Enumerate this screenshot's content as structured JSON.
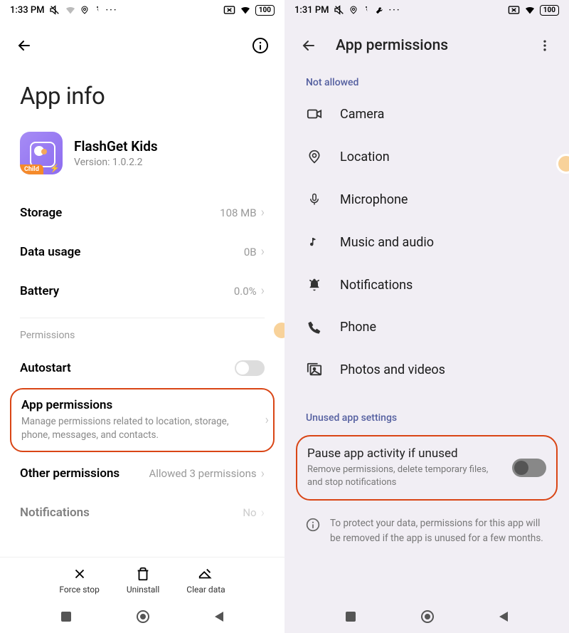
{
  "left": {
    "status": {
      "time": "1:33 PM",
      "battery": "100"
    },
    "page_title": "App info",
    "app": {
      "name": "FlashGet Kids",
      "version": "Version: 1.0.2.2",
      "child_badge": "Child"
    },
    "rows": {
      "storage": {
        "label": "Storage",
        "value": "108 MB"
      },
      "data": {
        "label": "Data usage",
        "value": "0B"
      },
      "battery": {
        "label": "Battery",
        "value": "0.0%"
      }
    },
    "sections": {
      "permissions": "Permissions"
    },
    "autostart": {
      "label": "Autostart"
    },
    "app_perms": {
      "label": "App permissions",
      "sub": "Manage permissions related to location, storage, phone, messages, and contacts."
    },
    "other_perms": {
      "label": "Other permissions",
      "value": "Allowed 3 permissions"
    },
    "notifications": {
      "label": "Notifications",
      "value": "No"
    },
    "actions": {
      "force_stop": "Force stop",
      "uninstall": "Uninstall",
      "clear_data": "Clear data"
    }
  },
  "right": {
    "status": {
      "time": "1:31 PM",
      "battery": "100"
    },
    "header_title": "App permissions",
    "sections": {
      "not_allowed": "Not allowed",
      "unused": "Unused app settings"
    },
    "perms": {
      "camera": "Camera",
      "location": "Location",
      "microphone": "Microphone",
      "music": "Music and audio",
      "notifications": "Notifications",
      "phone": "Phone",
      "photos": "Photos and videos"
    },
    "pause": {
      "title": "Pause app activity if unused",
      "sub": "Remove permissions, delete temporary files, and stop notifications"
    },
    "footer": "To protect your data, permissions for this app will be removed if the app is unused for a few months."
  }
}
